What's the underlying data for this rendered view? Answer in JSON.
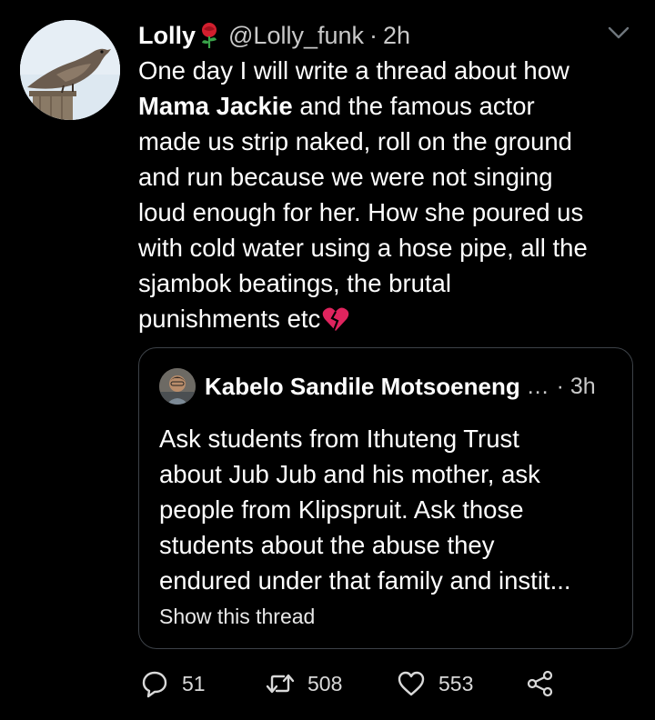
{
  "tweet": {
    "author_name": "Lolly",
    "handle": "@Lolly_funk",
    "separator": "·",
    "time": "2h",
    "text_lines": [
      "One day I will write a thread about how",
      "and the famous actor",
      "made us strip naked, roll on the ground",
      "and run because we were not singing",
      "loud enough for her. How she poured us",
      "with cold water using a hose pipe, all the",
      "sjambok beatings, the brutal",
      "punishments etc"
    ],
    "bold_name": "Mama Jackie"
  },
  "quote": {
    "author_name": "Kabelo Sandile Motsoeneng",
    "truncation": "...",
    "separator": "·",
    "time": "3h",
    "text_lines": [
      "Ask students from Ithuteng Trust",
      "about Jub Jub and his mother, ask",
      "people from Klipspruit. Ask those",
      "students about the abuse they",
      "endured under that family and instit..."
    ],
    "show_thread": "Show this thread"
  },
  "actions": {
    "replies": "51",
    "retweets": "508",
    "likes": "553"
  },
  "icons": {
    "caret": "chevron-down-icon",
    "rose": "rose-emoji",
    "broken_heart": "broken-heart-emoji",
    "reply": "reply-icon",
    "retweet": "retweet-icon",
    "like": "heart-icon",
    "share": "share-icon"
  },
  "colors": {
    "background": "#000000",
    "text": "#ffffff",
    "muted": "#c9c9c9",
    "border": "#3d4248",
    "broken_heart": "#e0245e"
  }
}
